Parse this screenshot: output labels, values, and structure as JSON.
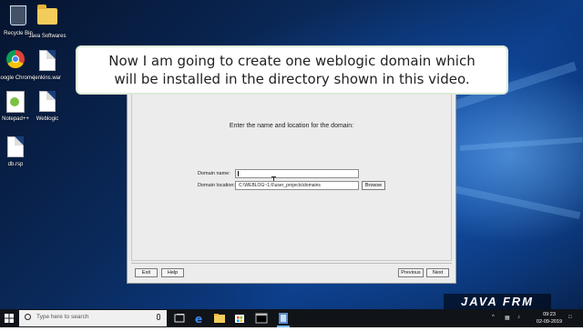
{
  "desktop": {
    "icons": [
      {
        "label": "Recycle Bin"
      },
      {
        "label": "Java Softwares"
      },
      {
        "label": "Google Chrome"
      },
      {
        "label": "jenkins.war"
      },
      {
        "label": "Notepad++"
      },
      {
        "label": "Weblogic"
      },
      {
        "label": "db.rsp"
      }
    ]
  },
  "caption": {
    "line1": "Now I am going to create one weblogic domain which",
    "line2": "will be installed in the directory shown in this video."
  },
  "dialog": {
    "heading": "Enter the name and location for the domain:",
    "domain_name_label": "Domain name:",
    "domain_name_value": "",
    "domain_location_label": "Domain location:",
    "domain_location_value": "C:\\WEBLOG~1.6\\user_projects\\domains",
    "browse_label": "Browse",
    "exit_label": "Exit",
    "help_label": "Help",
    "previous_label": "Previous",
    "next_label": "Next"
  },
  "watermark": "JAVA FRM",
  "taskbar": {
    "search_placeholder": "Type here to search",
    "time": "09:23",
    "date": "02-09-2019",
    "accent": "#7ab8f5"
  }
}
